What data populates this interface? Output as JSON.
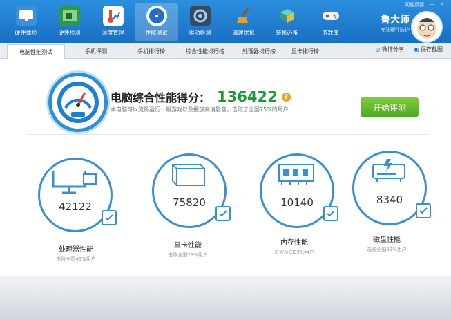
{
  "nav": [
    {
      "label": "硬件体检",
      "icon": "monitor-icon",
      "color": "#3a8fe0"
    },
    {
      "label": "硬件检测",
      "icon": "circuit-board-icon",
      "color": "#2a9a4a"
    },
    {
      "label": "温度管理",
      "icon": "thermometer-icon",
      "color": "#e04a3a"
    },
    {
      "label": "性能测试",
      "icon": "speedometer-icon",
      "color": "#1d6fd0"
    },
    {
      "label": "驱动检测",
      "icon": "driver-gear-icon",
      "color": "#3a4a5a"
    },
    {
      "label": "清理优化",
      "icon": "broom-icon",
      "color": "#c87a20"
    },
    {
      "label": "装机必备",
      "icon": "cube-box-icon",
      "color": "#3a9a8a"
    },
    {
      "label": "游戏库",
      "icon": "gamepad-icon",
      "color": "#eaeaea"
    }
  ],
  "topright": [
    "问题反馈"
  ],
  "brand": {
    "name": "鲁大师",
    "slogan": "专注硬件防护"
  },
  "tabs": [
    "电脑性能测试",
    "手机评测",
    "手机排行榜",
    "综合性能排行榜",
    "处理器排行榜",
    "显卡排行榜"
  ],
  "tools": {
    "share": "微博分享",
    "save": "保存截图"
  },
  "score": {
    "title": "电脑综合性能得分：",
    "value": "136422",
    "help": "?",
    "desc_pre": "本电脑可以流畅运行一般游戏以及播放高清影音，击败了全国",
    "desc_pct": "75%",
    "desc_post": "的用户"
  },
  "start_button": "开始评测",
  "metrics": [
    {
      "name": "处理器性能",
      "value": "42122",
      "sub": "击败全国49%用户",
      "icon": "cpu-monitor-icon"
    },
    {
      "name": "显卡性能",
      "value": "75820",
      "sub": "击败全国79%用户",
      "icon": "gpu-cube-icon"
    },
    {
      "name": "内存性能",
      "value": "10140",
      "sub": "击败全国99%用户",
      "icon": "memory-chip-icon"
    },
    {
      "name": "磁盘性能",
      "value": "8340",
      "sub": "击败全国82%用户",
      "icon": "hard-disk-icon"
    }
  ],
  "accent": "#2b8fdd"
}
